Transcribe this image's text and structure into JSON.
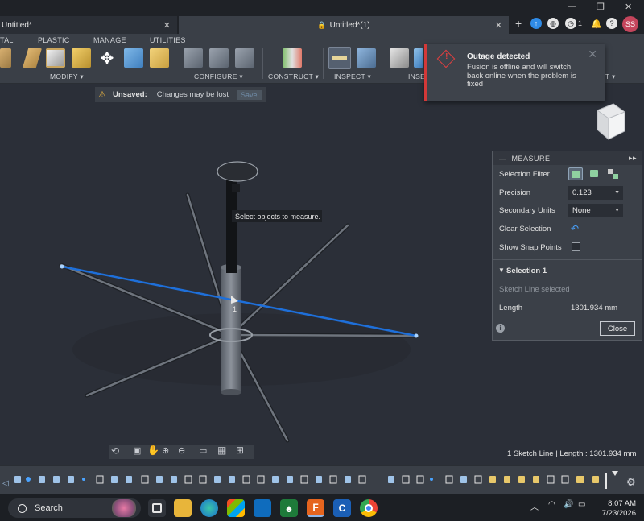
{
  "titlebar": {
    "tab1": "Untitled*",
    "tab2": "Untitled*(1)",
    "notif_count": "1",
    "avatar": "SS",
    "minimize": "—",
    "restore": "❐",
    "close": "✕"
  },
  "menu_tabs": [
    "TAL",
    "PLASTIC",
    "MANAGE",
    "UTILITIES"
  ],
  "toolbar_groups": [
    "MODIFY ▾",
    "CONFIGURE ▾",
    "CONSTRUCT ▾",
    "INSPECT ▾",
    "INSE",
    "T ▾"
  ],
  "unsaved": {
    "label": "Unsaved:",
    "message": "Changes may be lost",
    "save": "Save"
  },
  "toast": {
    "title": "Outage detected",
    "body": "Fusion is offline and will switch back online when the problem is fixed"
  },
  "tooltip": "Select objects to measure.",
  "measure": {
    "title": "MEASURE",
    "selection_filter": "Selection Filter",
    "precision_label": "Precision",
    "precision_value": "0.123",
    "secondary_units_label": "Secondary Units",
    "secondary_units_value": "None",
    "clear_selection": "Clear Selection",
    "show_snap_points": "Show Snap Points",
    "selection_header": "Selection 1",
    "selection_desc": "Sketch Line selected",
    "length_label": "Length",
    "length_value": "1301.934 mm",
    "close": "Close"
  },
  "canvas": {
    "point_label": "1"
  },
  "status": "1 Sketch Line | Length : 1301.934 mm",
  "taskbar": {
    "search": "Search",
    "time": "8:07 AM",
    "date": "7/23/2026"
  },
  "colors": {
    "accent_blue": "#1e6fd9",
    "toast_red": "#d33838",
    "panel_bg": "#3b4048"
  }
}
